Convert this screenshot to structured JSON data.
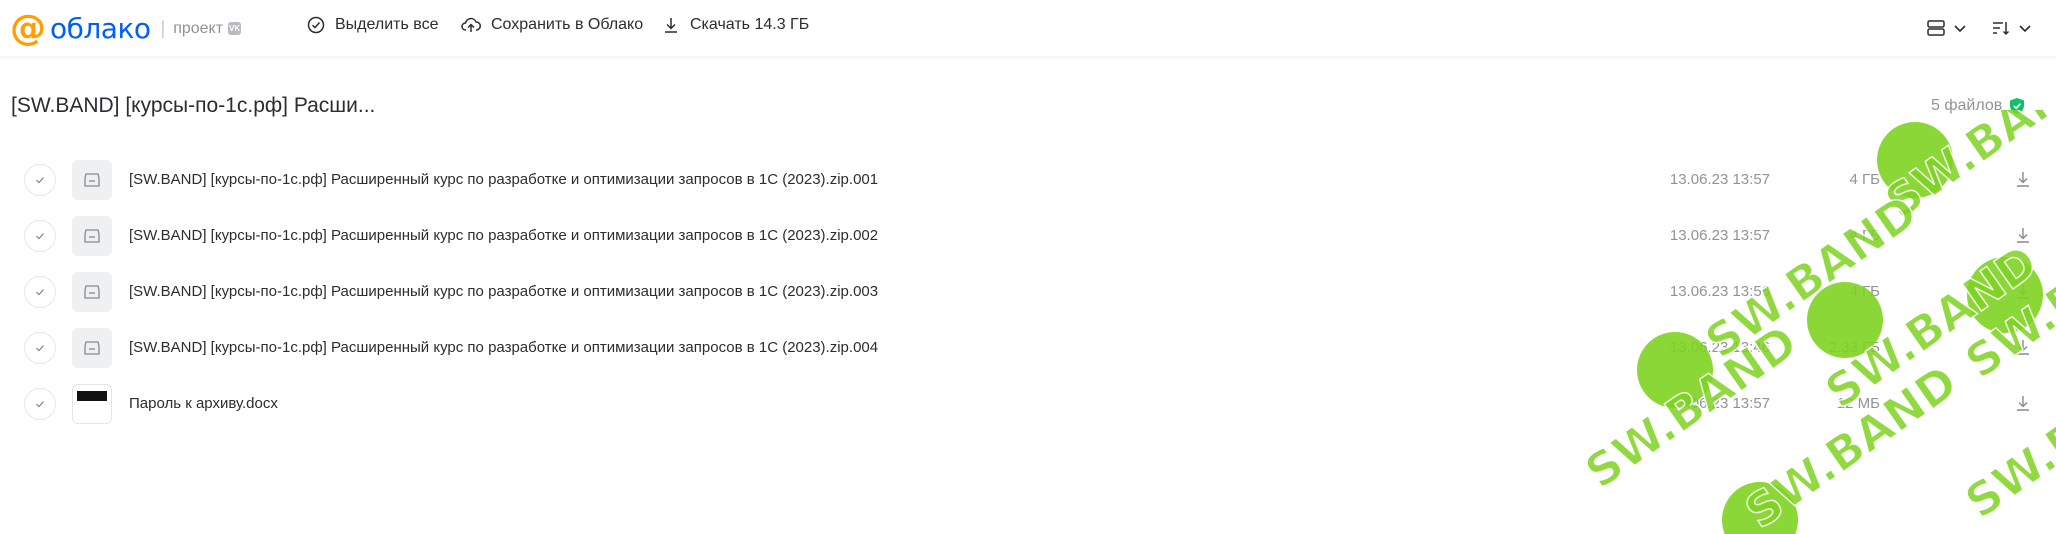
{
  "header": {
    "logo_symbol": "@",
    "logo_word": "облако",
    "project_label": "проект",
    "vk_badge": "VK",
    "select_all_label": "Выделить все",
    "save_label": "Сохранить в Облако",
    "download_label": "Скачать 14.3 ГБ"
  },
  "folder": {
    "title": "[SW.BAND] [курсы-по-1с.рф] Расши...",
    "file_count": "5 файлов"
  },
  "files": [
    {
      "name": "[SW.BAND] [курсы-по-1с.рф] Расширенный курс по разработке и оптимизации запросов в 1С (2023).zip.001",
      "date": "13.06.23 13:57",
      "size": "4 ГБ",
      "icon": "archive-icon"
    },
    {
      "name": "[SW.BAND] [курсы-по-1с.рф] Расширенный курс по разработке и оптимизации запросов в 1С (2023).zip.002",
      "date": "13.06.23 13:57",
      "size": "4 ГБ",
      "icon": "archive-icon"
    },
    {
      "name": "[SW.BAND] [курсы-по-1с.рф] Расширенный курс по разработке и оптимизации запросов в 1С (2023).zip.003",
      "date": "13.06.23 13:56",
      "size": "4 ГБ",
      "icon": "archive-icon"
    },
    {
      "name": "[SW.BAND] [курсы-по-1с.рф] Расширенный курс по разработке и оптимизации запросов в 1С (2023).zip.004",
      "date": "13.06.23 13:46",
      "size": "2.33 ГБ",
      "icon": "archive-icon"
    },
    {
      "name": "Пароль к архиву.docx",
      "date": "13.06.23 13:57",
      "size": "12 МБ",
      "icon": "document-thumbnail"
    }
  ],
  "watermark": {
    "text": "SW.BAND"
  },
  "colors": {
    "accent_orange": "#ff9e00",
    "brand_blue": "#005ff9",
    "shield_green": "#0dc268",
    "watermark_green": "#7ed321"
  }
}
